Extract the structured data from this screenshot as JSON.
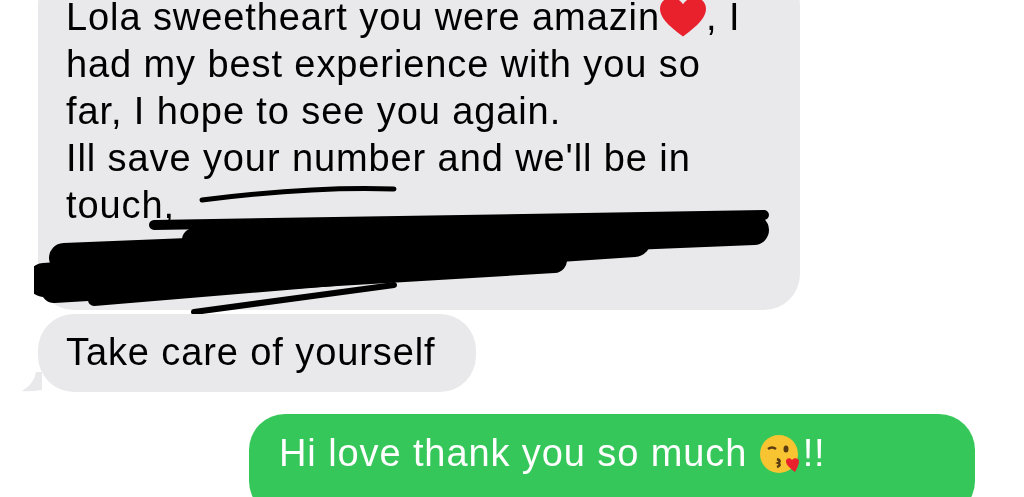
{
  "messages": [
    {
      "kind": "received",
      "tail": false,
      "redacted": true,
      "lines": [
        [
          {
            "kind": "text",
            "text": "Lola sweetheart you were amazin"
          },
          {
            "kind": "heart"
          },
          {
            "kind": "text",
            "text": ", I"
          }
        ],
        [
          {
            "kind": "text",
            "text": "had my best experience with you so"
          }
        ],
        [
          {
            "kind": "text",
            "text": "far, I hope to see you again."
          }
        ],
        [
          {
            "kind": "text",
            "text": "Ill save your number and we'll be in"
          }
        ],
        [
          {
            "kind": "text",
            "text": "touch,"
          }
        ]
      ]
    },
    {
      "kind": "received",
      "tail": true,
      "redacted": false,
      "lines": [
        [
          {
            "kind": "text",
            "text": "Take care of yourself"
          }
        ]
      ]
    },
    {
      "kind": "sent",
      "tail": false,
      "redacted": false,
      "lines": [
        [
          {
            "kind": "text",
            "text": "Hi love thank you so much "
          },
          {
            "kind": "kiss"
          },
          {
            "kind": "text",
            "text": "!!"
          }
        ]
      ]
    }
  ]
}
